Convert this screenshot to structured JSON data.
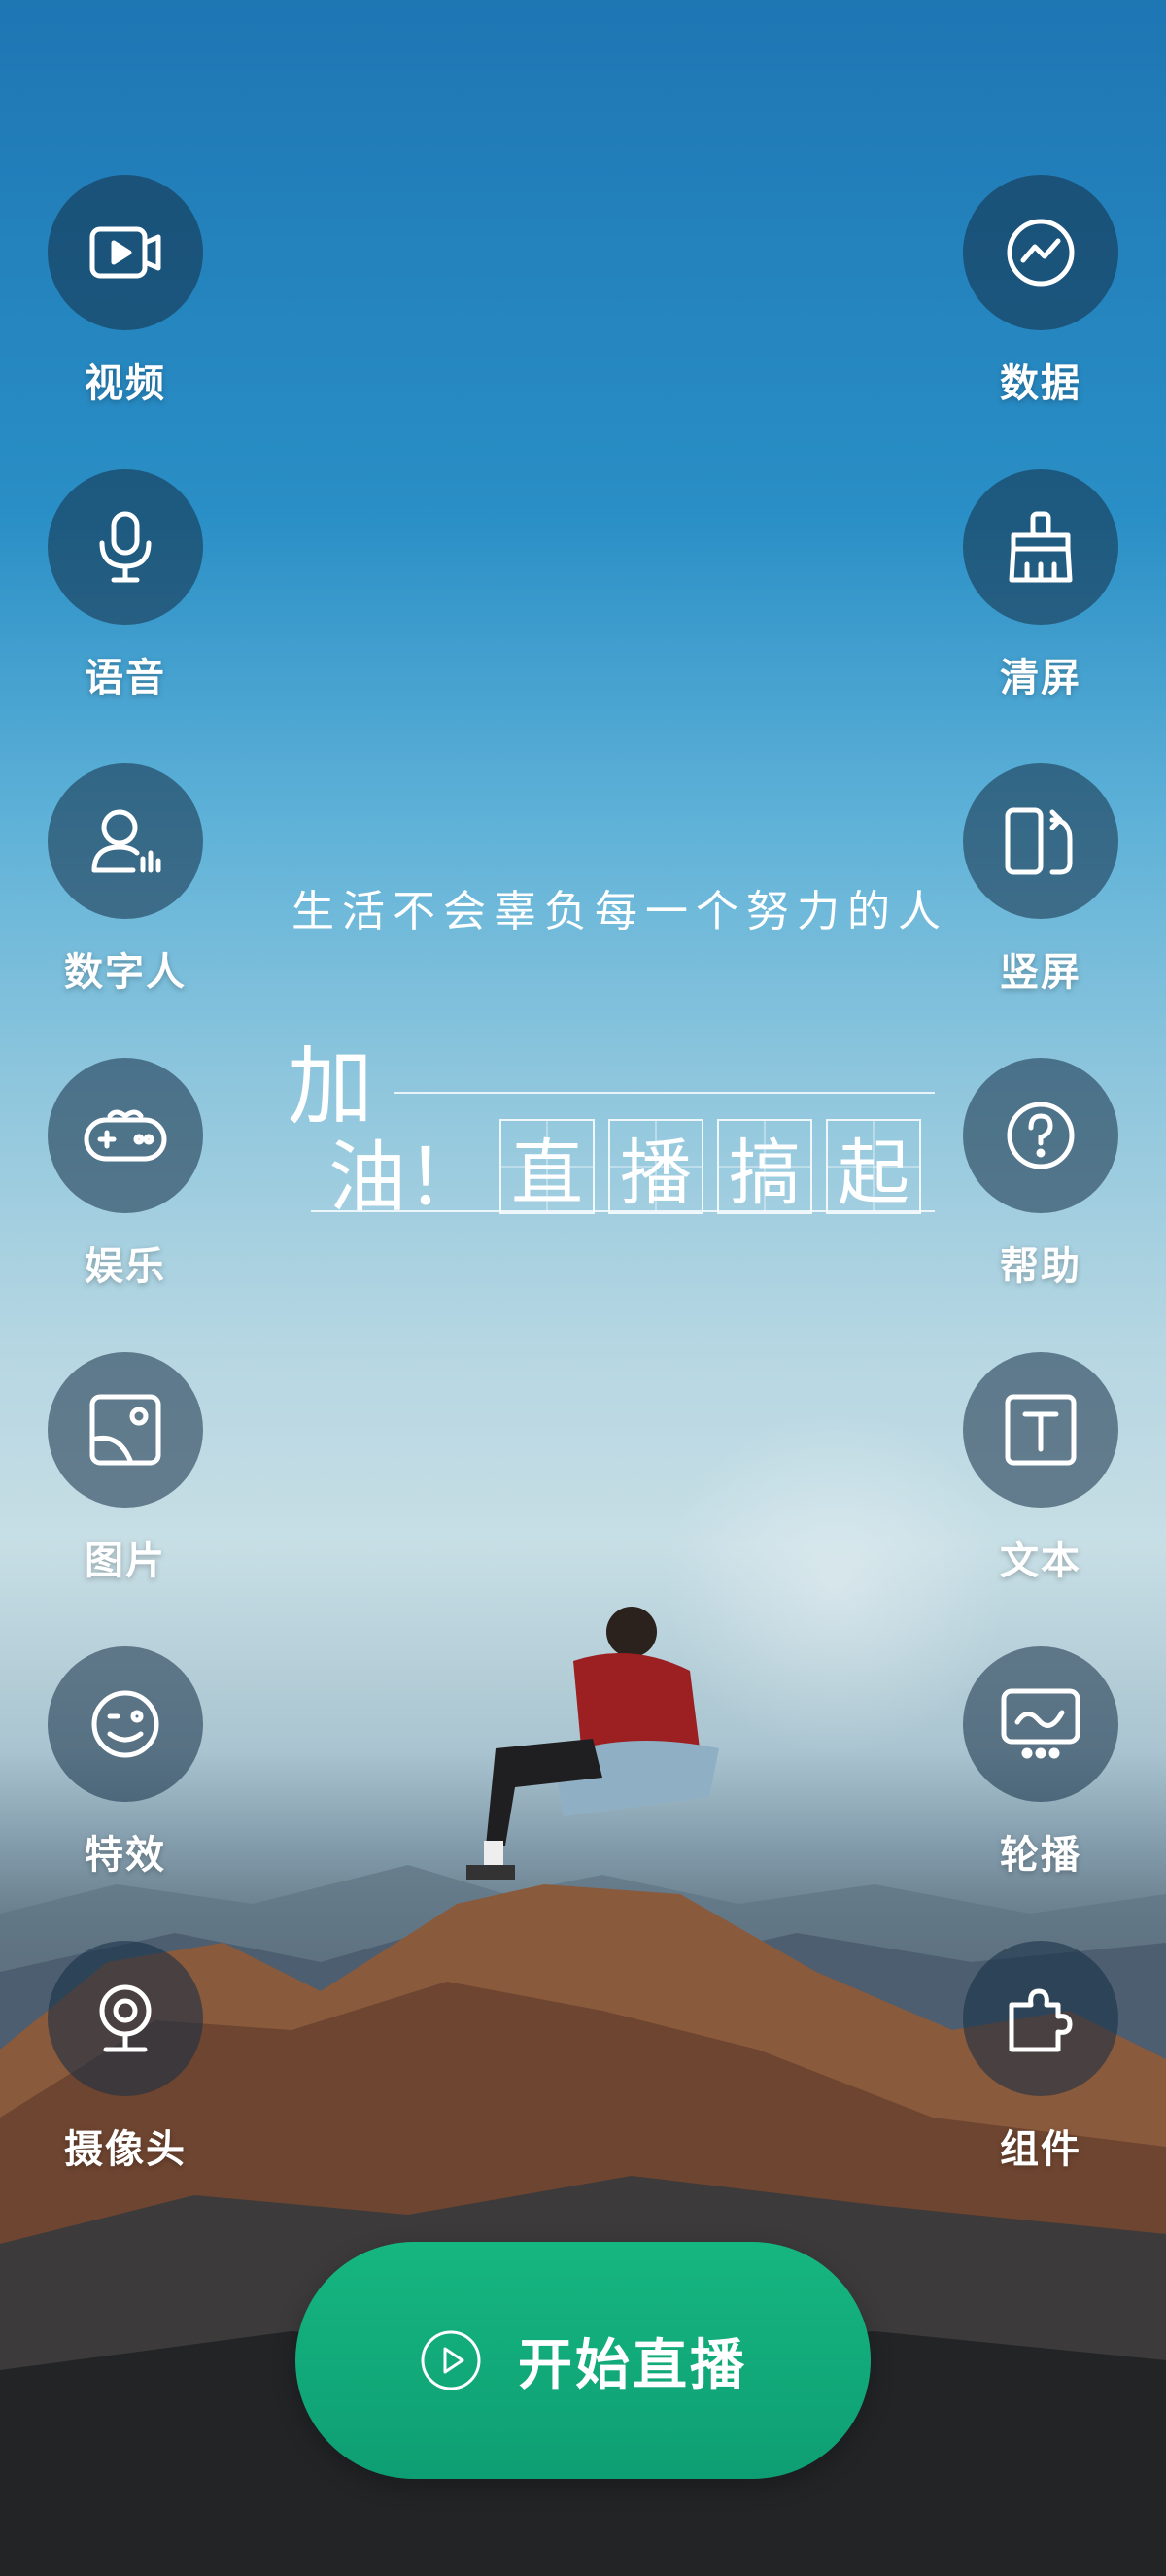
{
  "left_menu": [
    {
      "label": "视频",
      "icon": "video-icon"
    },
    {
      "label": "语音",
      "icon": "microphone-icon"
    },
    {
      "label": "数字人",
      "icon": "digital-human-icon"
    },
    {
      "label": "娱乐",
      "icon": "gamepad-icon"
    },
    {
      "label": "图片",
      "icon": "image-icon"
    },
    {
      "label": "特效",
      "icon": "smiley-icon"
    },
    {
      "label": "摄像头",
      "icon": "webcam-icon"
    }
  ],
  "right_menu": [
    {
      "label": "数据",
      "icon": "chart-icon"
    },
    {
      "label": "清屏",
      "icon": "broom-icon"
    },
    {
      "label": "竖屏",
      "icon": "rotate-screen-icon"
    },
    {
      "label": "帮助",
      "icon": "help-icon"
    },
    {
      "label": "文本",
      "icon": "text-icon"
    },
    {
      "label": "轮播",
      "icon": "carousel-icon"
    },
    {
      "label": "组件",
      "icon": "puzzle-icon"
    }
  ],
  "overlay": {
    "slogan": "生活不会辜负每一个努力的人",
    "cheer_part1": "加",
    "cheer_part2": "油！",
    "cheer_chars": [
      "直",
      "播",
      "搞",
      "起"
    ]
  },
  "start_button": {
    "label": "开始直播",
    "icon": "play-circle-icon"
  }
}
